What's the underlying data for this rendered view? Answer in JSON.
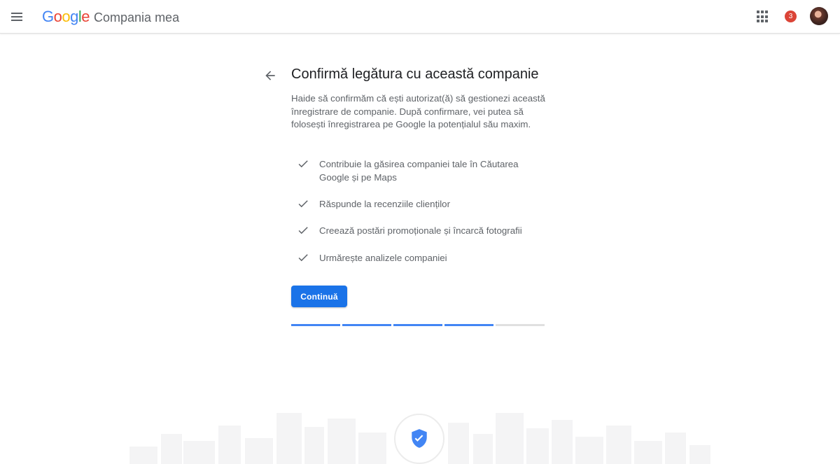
{
  "header": {
    "logo_letters": [
      {
        "ch": "G",
        "color": "#4285F4"
      },
      {
        "ch": "o",
        "color": "#EA4335"
      },
      {
        "ch": "o",
        "color": "#FBBC05"
      },
      {
        "ch": "g",
        "color": "#4285F4"
      },
      {
        "ch": "l",
        "color": "#34A853"
      },
      {
        "ch": "e",
        "color": "#EA4335"
      }
    ],
    "product_name": "Compania mea",
    "notification_count": "3"
  },
  "main": {
    "title": "Confirmă legătura cu această companie",
    "description": "Haide să confirmăm că ești autorizat(ă) să gestionezi această înregistrare de companie. După confirmare, vei putea să folosești înregistrarea pe Google la potențialul său maxim.",
    "checklist": [
      "Contribuie la găsirea companiei tale în Căutarea Google și pe Maps",
      "Răspunde la recenziile clienților",
      "Creează postări promoționale și încarcă fotografii",
      "Urmărește analizele companiei"
    ],
    "continue_label": "Continuă"
  },
  "progress": {
    "total_steps": 5,
    "completed_steps": 4,
    "active_color": "#4285f4",
    "inactive_color": "#e0e0e0"
  },
  "colors": {
    "accent": "#1a73e8",
    "shield": "#4285f4"
  }
}
